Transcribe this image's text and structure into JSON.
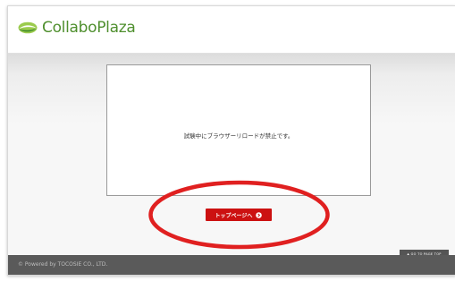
{
  "header": {
    "logo_text": "CollaboPlaza"
  },
  "main": {
    "message": "試験中にブラウザーリロードが禁止です。",
    "top_button_label": "トップページへ"
  },
  "goto_top_label": "▲ GO TO PAGE TOP",
  "footer": {
    "copyright": "© Powered by TOCOSIE CO., LTD."
  },
  "colors": {
    "brand_green": "#4f8f2e",
    "button_red": "#cc1111",
    "highlight_red": "#e02020",
    "footer_gray": "#5a5a5a"
  },
  "icons": {
    "logo": "collaboplaza-leaf-icon",
    "button": "arrow-circle-icon"
  }
}
